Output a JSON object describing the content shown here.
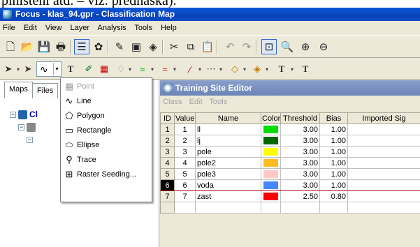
{
  "doc_text": "plnistění atd. – viz. přednáška).",
  "window": {
    "title": "Focus - klas_94.gpr - Classification Map"
  },
  "menubar": [
    "File",
    "Edit",
    "View",
    "Layer",
    "Analysis",
    "Tools",
    "Help"
  ],
  "toolbar1_icons": [
    "new-icon",
    "open-icon",
    "save-icon",
    "print-icon",
    "layer-list-icon",
    "paint-icon",
    "draw-icon",
    "square-icon",
    "layers-icon",
    "cut-icon",
    "copy-icon",
    "paste-icon",
    "undo-icon",
    "redo-icon",
    "zoom-extent-icon",
    "zoom-icon",
    "zoom-in-icon",
    "zoom-out-icon"
  ],
  "left_panel": {
    "tabs": [
      "Maps",
      "Files"
    ],
    "tree_label": "Cl"
  },
  "shape_menu": {
    "items": [
      {
        "label": "Point",
        "icon": "point-icon",
        "glyph": "▦",
        "disabled": true
      },
      {
        "label": "Line",
        "icon": "line-icon",
        "glyph": "∿",
        "disabled": false
      },
      {
        "label": "Polygon",
        "icon": "polygon-icon",
        "glyph": "⬠",
        "disabled": false
      },
      {
        "label": "Rectangle",
        "icon": "rectangle-icon",
        "glyph": "▭",
        "disabled": false
      },
      {
        "label": "Ellipse",
        "icon": "ellipse-icon",
        "glyph": "⬭",
        "disabled": false
      },
      {
        "label": "Trace",
        "icon": "trace-icon",
        "glyph": "⚲",
        "disabled": false
      },
      {
        "label": "Raster Seeding...",
        "icon": "raster-seeding-icon",
        "glyph": "⊞",
        "disabled": false
      }
    ]
  },
  "editor": {
    "title": "Training Site Editor",
    "menu": [
      "Class",
      "Edit",
      "Tools"
    ],
    "columns": [
      "ID",
      "Value",
      "Name",
      "Color",
      "Threshold",
      "Bias",
      "Imported Sig"
    ],
    "rows": [
      {
        "id": "1",
        "value": "1",
        "name": "ll",
        "color": "#00dd00",
        "threshold": "3.00",
        "bias": "1.00",
        "imported": ""
      },
      {
        "id": "2",
        "value": "2",
        "name": "lj",
        "color": "#006600",
        "threshold": "3.00",
        "bias": "1.00",
        "imported": ""
      },
      {
        "id": "3",
        "value": "3",
        "name": "pole",
        "color": "#ffff00",
        "threshold": "3.00",
        "bias": "1.00",
        "imported": ""
      },
      {
        "id": "4",
        "value": "4",
        "name": "pole2",
        "color": "#ffbb22",
        "threshold": "3.00",
        "bias": "1.00",
        "imported": ""
      },
      {
        "id": "5",
        "value": "5",
        "name": "pole3",
        "color": "#ffc8c8",
        "threshold": "3.00",
        "bias": "1.00",
        "imported": ""
      },
      {
        "id": "6",
        "value": "6",
        "name": "voda",
        "color": "#4488ff",
        "threshold": "3.00",
        "bias": "1.00",
        "imported": ""
      },
      {
        "id": "7",
        "value": "7",
        "name": "zast",
        "color": "#ff0000",
        "threshold": "2.50",
        "bias": "0.80",
        "imported": ""
      }
    ],
    "selected_id": "6"
  }
}
